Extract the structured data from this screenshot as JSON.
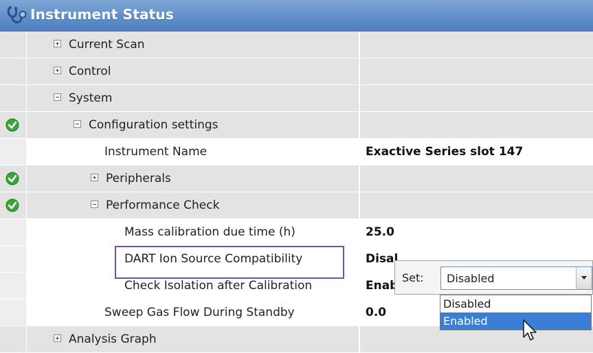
{
  "panel": {
    "title": "Instrument Status",
    "icon": "stethoscope-icon"
  },
  "rows": [
    {
      "label": "Current Scan",
      "value": "",
      "expander": "plus",
      "check": false
    },
    {
      "label": "Control",
      "value": "",
      "expander": "plus",
      "check": false
    },
    {
      "label": "System",
      "value": "",
      "expander": "minus",
      "check": false
    },
    {
      "label": "Configuration settings",
      "value": "",
      "expander": "minus",
      "check": true
    },
    {
      "label": "Instrument Name",
      "value": "Exactive Series slot 147",
      "expander": "none",
      "check": false
    },
    {
      "label": "Peripherals",
      "value": "",
      "expander": "plus",
      "check": true
    },
    {
      "label": "Performance Check",
      "value": "",
      "expander": "minus",
      "check": true
    },
    {
      "label": "Mass calibration due time (h)",
      "value": "25.0",
      "expander": "none",
      "check": false
    },
    {
      "label": "DART Ion Source Compatibility",
      "value": "Disal",
      "expander": "none",
      "check": false
    },
    {
      "label": "Check Isolation after Calibration",
      "value": "Enab",
      "expander": "none",
      "check": false
    },
    {
      "label": "Sweep Gas Flow During Standby",
      "value": "0.0",
      "expander": "none",
      "check": false
    },
    {
      "label": "Analysis Graph",
      "value": "",
      "expander": "plus",
      "check": false
    }
  ],
  "dropdown": {
    "set_label": "Set:",
    "selected_value": "Disabled",
    "options": [
      "Disabled",
      "Enabled"
    ],
    "highlighted_option": "Enabled"
  },
  "colors": {
    "title_bar": "#5f8ec7",
    "row_gray": "#e3e3e3",
    "highlight_border": "#7a4f9e",
    "selected_option": "#3a7fd5",
    "check_green": "#3aa63a"
  }
}
